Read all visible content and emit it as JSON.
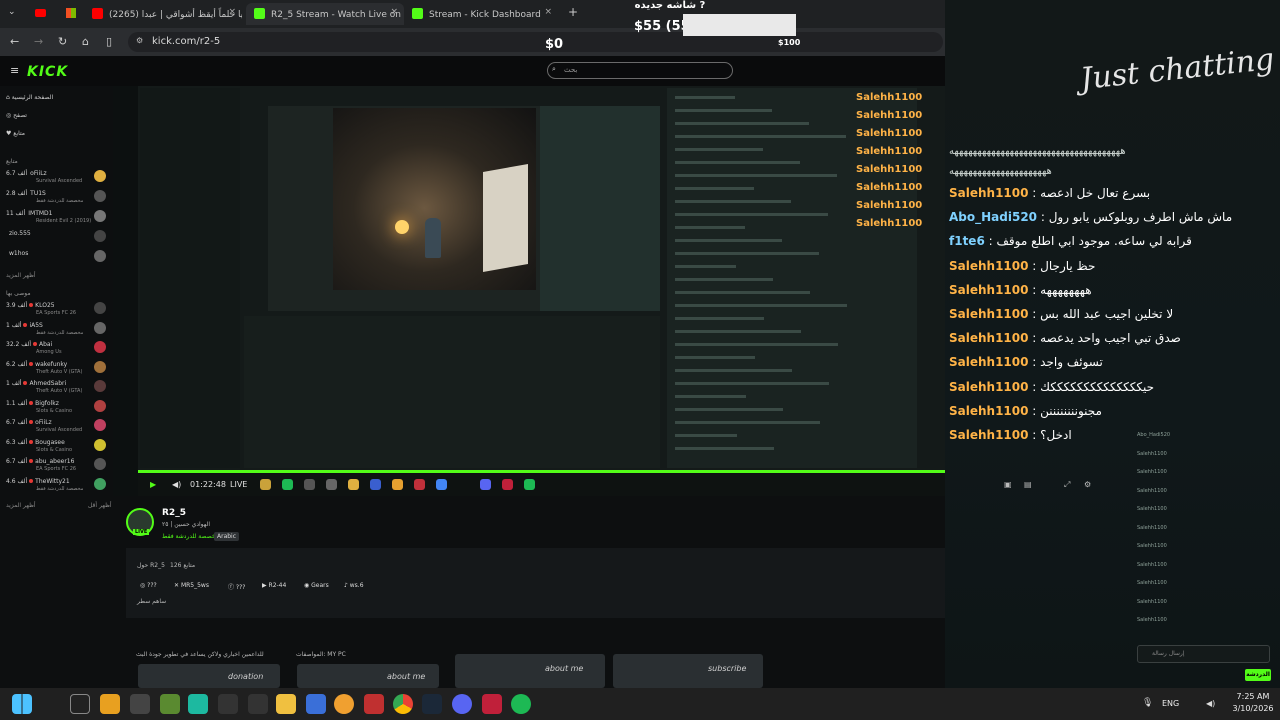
{
  "browser": {
    "tabs": [
      {
        "label": "(2265) يا حلماً أيقظ أشواقي | عبدا",
        "color": "#ff0000"
      },
      {
        "label": "R2_5 Stream - Watch Live on Kick",
        "color": "#53fc18"
      },
      {
        "label": "Stream - Kick Dashboard",
        "color": "#53fc18"
      }
    ],
    "close_glyph": "×",
    "new_tab": "+",
    "url": "kick.com/r2-5"
  },
  "overlay": {
    "goal_title": "شاشه جديده ?",
    "goal_value": "$55 (55.0",
    "goal_min": "$0",
    "goal_max": "$100",
    "goal_progress": 0.55
  },
  "kick": {
    "logo": "KICK",
    "search_placeholder": "بحث",
    "sidebar": {
      "nav": [
        "الصفحة الرئيسية",
        "تصفح",
        "متابع"
      ],
      "following_header": "متابع",
      "followed": [
        {
          "name": "oFiiLz",
          "viewers": "6.7 ألف",
          "category": "Survival Ascended"
        },
        {
          "name": "TU1S",
          "viewers": "2.8 ألف",
          "category": "مخصصة للدردشة فقط"
        },
        {
          "name": "IMTMD1",
          "viewers": "11 ألف",
          "category": "Resident Evil 2 (2019)"
        },
        {
          "name": "zio.555",
          "viewers": "",
          "category": ""
        },
        {
          "name": "w1hos",
          "viewers": "",
          "category": ""
        }
      ],
      "show_more": "أظهر المزيد",
      "recommended_header": "موصى بها",
      "recommended": [
        {
          "name": "KLO25",
          "viewers": "3.9 ألف",
          "category": "EA Sports FC 26"
        },
        {
          "name": "iA5S",
          "viewers": "1 ألف",
          "category": "مخصصة للدردشة فقط"
        },
        {
          "name": "Abai",
          "viewers": "32.2 ألف",
          "category": "Among Us"
        },
        {
          "name": "wakefunky",
          "viewers": "6.2 ألف",
          "category": "Theft Auto V (GTA)"
        },
        {
          "name": "AhmedSabri",
          "viewers": "1 ألف",
          "category": "Theft Auto V (GTA)"
        },
        {
          "name": "Bigfolkz",
          "viewers": "1.1 ألف",
          "category": "Slots & Casino"
        },
        {
          "name": "oFiiLz",
          "viewers": "6.7 ألف",
          "category": "Survival Ascended"
        },
        {
          "name": "Bougasee",
          "viewers": "6.3 ألف",
          "category": "Slots & Casino"
        },
        {
          "name": "abu_abeer16",
          "viewers": "6.7 ألف",
          "category": "EA Sports FC 26"
        },
        {
          "name": "TheWitty21",
          "viewers": "4.6 ألف",
          "category": "مخصصة للدردشة فقط"
        }
      ],
      "footer_left": "أظهر المزيد",
      "footer_right": "أظهر أقل"
    },
    "player": {
      "time": "01:22:48",
      "live": "LIVE"
    },
    "streamer": {
      "name": "R2_5",
      "title": "الهوادي حسين | ٢٥",
      "category": "مخصصة للدردشة فقط",
      "language": "Arabic",
      "live_badge": "LIVE",
      "about_heading": "حول R2_5",
      "followers_label": "متابع 126",
      "socials": [
        "???",
        "MR5_5ws",
        "???",
        "R2-44",
        "Gears",
        "ws.6"
      ],
      "tip": "ساهم سطر"
    },
    "panels": {
      "specs_label": "المواصفات: MY PC",
      "thanks_label": "للداعمين اخباري ولاكن يساعد في تطوير جودة البث",
      "tiles": [
        "donation",
        "about me",
        "about me",
        "about me",
        "subscribe"
      ]
    }
  },
  "stream_overlay_chat": {
    "logo_text": "Just chatting",
    "header_spam": "هههههههههههههههههههههههههههههههههههههه",
    "header_spam2": "هههههههههههههههههههههه",
    "messages": [
      {
        "user": "Salehh1100",
        "text": "بسرع تعال خل ادعصه"
      },
      {
        "user": "Abo_Hadi520",
        "text": "ماش ماش اطرف روبلوكس يابو رول"
      },
      {
        "user": "f1te6",
        "text": "قرابه لي ساعه. موجود ابي اطلع موقف"
      },
      {
        "user": "Salehh1100",
        "text": "حظ يارجال"
      },
      {
        "user": "Salehh1100",
        "text": "ههههههههه"
      },
      {
        "user": "Salehh1100",
        "text": "لا تخلين اجيب عبد الله بس"
      },
      {
        "user": "Salehh1100",
        "text": "صدق تبي اجيب واحد يدعصه"
      },
      {
        "user": "Salehh1100",
        "text": "تسوئف واجد"
      },
      {
        "user": "Salehh1100",
        "text": "حيككككككككككككككك"
      },
      {
        "user": "Salehh1100",
        "text": "مجنوننننننننن"
      },
      {
        "user": "Salehh1100",
        "text": "ادخل؟"
      }
    ],
    "side_names": [
      "Salehh1100",
      "Salehh1100",
      "Salehh1100",
      "Salehh1100",
      "Salehh1100",
      "Salehh1100",
      "Salehh1100",
      "Salehh1100"
    ],
    "faint_lines": [
      "Abo_Hadi520",
      "Salehh1100",
      "Salehh1100",
      "Salehh1100",
      "Salehh1100",
      "Salehh1100",
      "Salehh1100",
      "Salehh1100",
      "Salehh1100",
      "Salehh1100",
      "Salehh1100"
    ],
    "input_placeholder": "إرسال رسالة",
    "send": "الدردشة"
  },
  "taskbar": {
    "lang": "ENG",
    "time": "7:25 AM",
    "date": "3/10/2026"
  },
  "colors": {
    "kick_green": "#53fc18",
    "username": "#ffb347"
  }
}
